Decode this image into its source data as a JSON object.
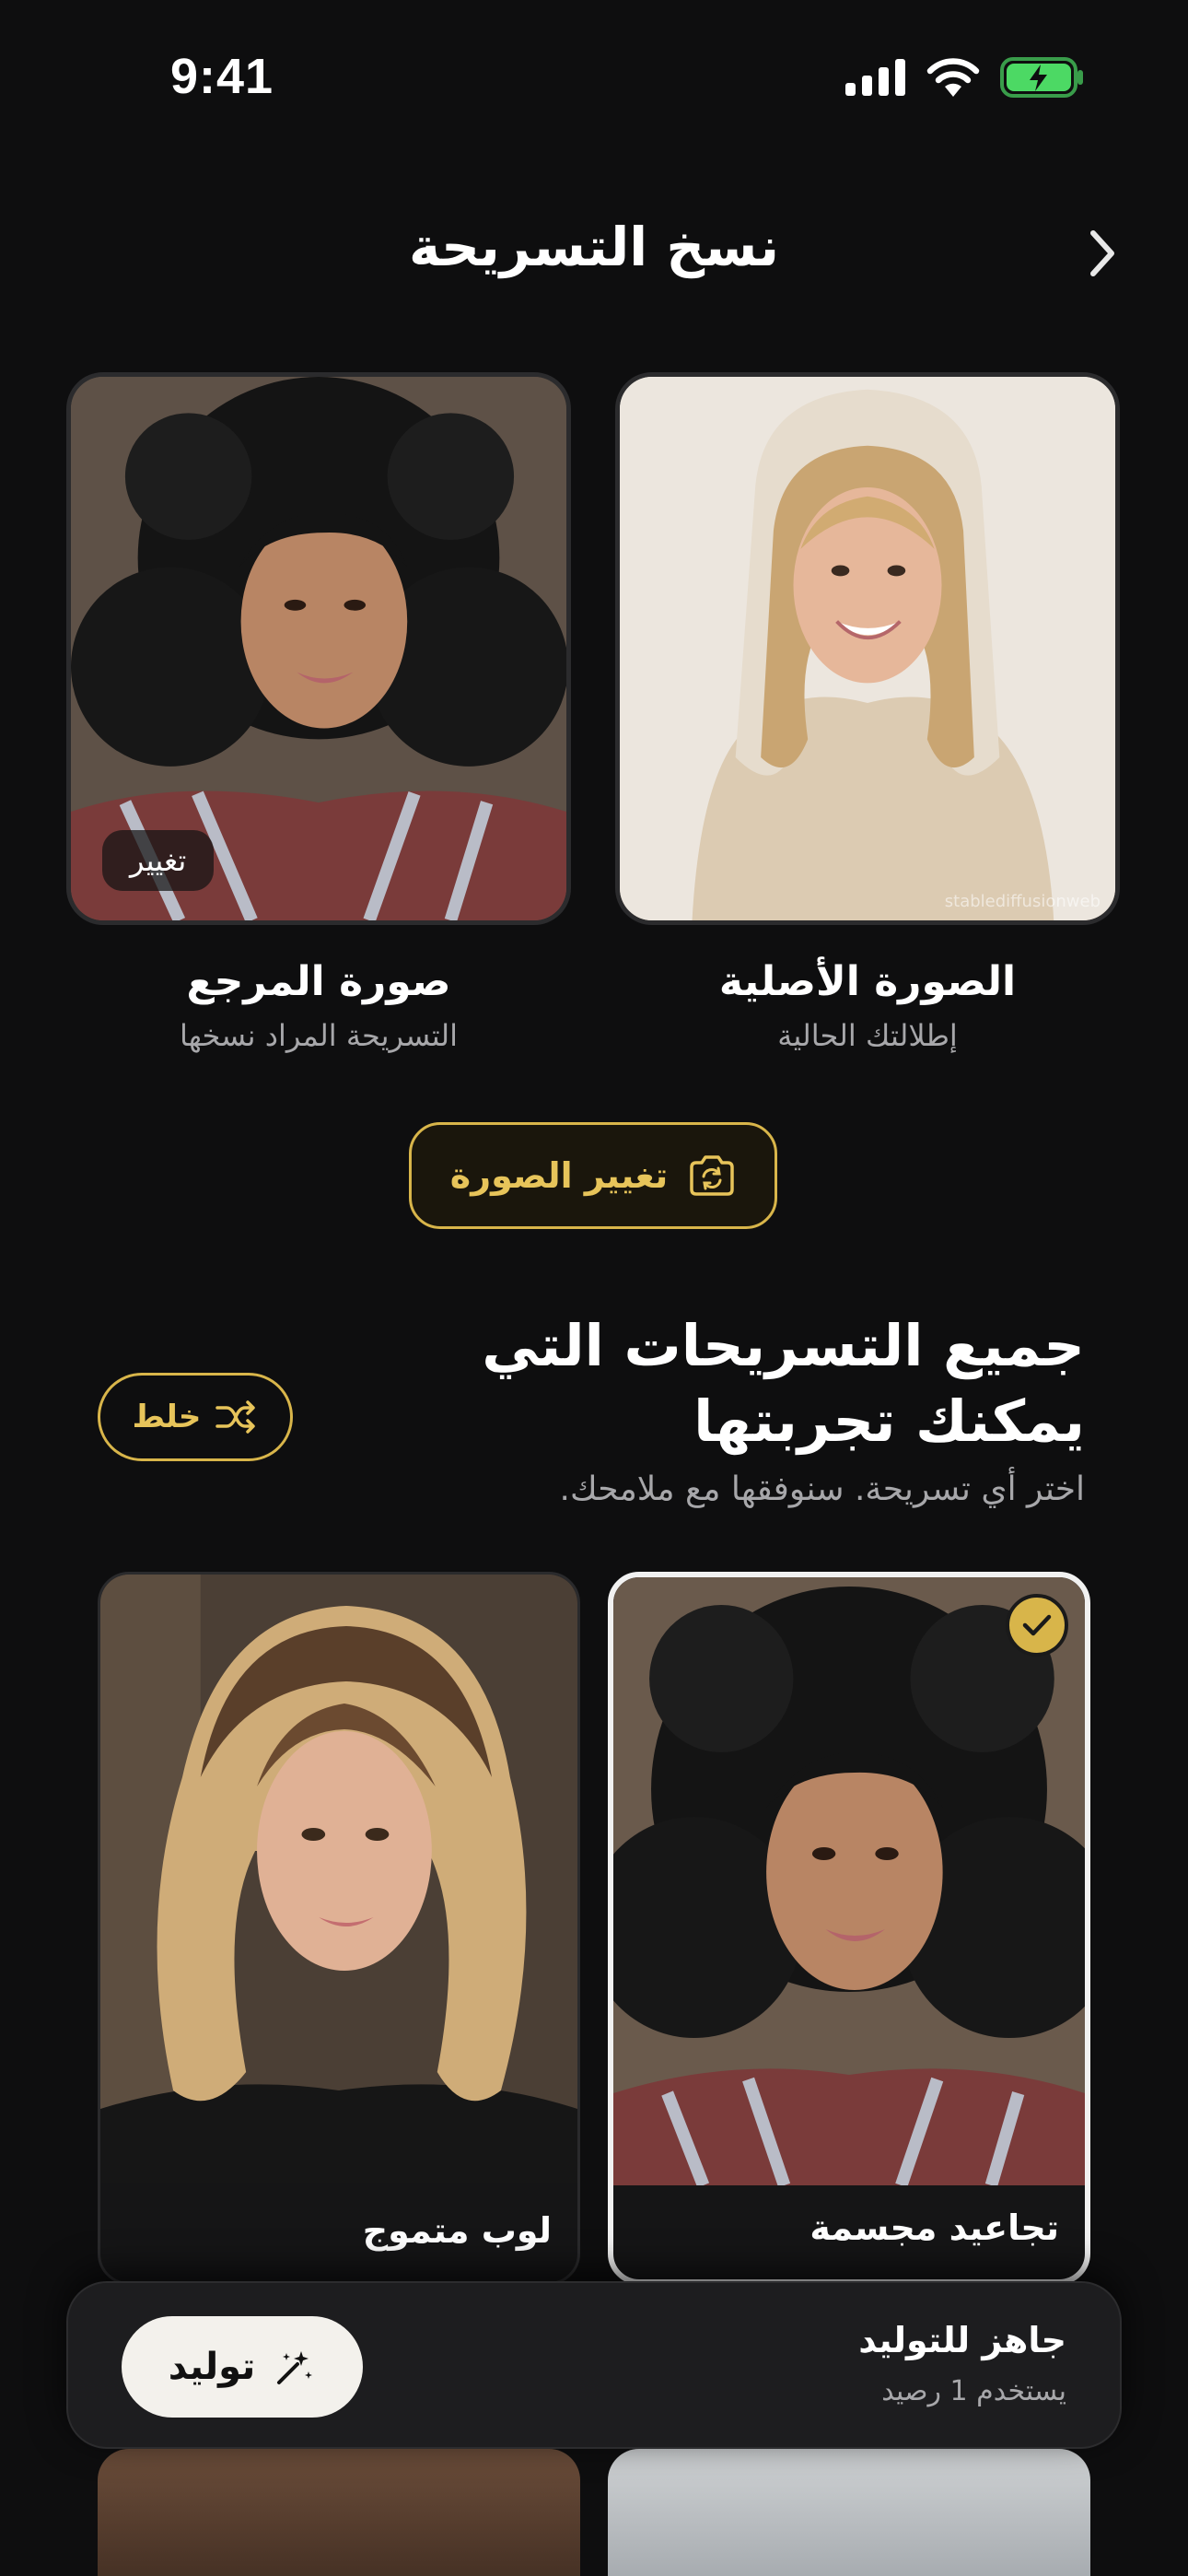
{
  "status_bar": {
    "time": "9:41"
  },
  "header": {
    "title": "نسخ التسريحة"
  },
  "photos": {
    "original": {
      "title": "الصورة الأصلية",
      "subtitle": "إطلالتك الحالية",
      "watermark": "stablediffusionweb"
    },
    "reference": {
      "title": "صورة المرجع",
      "subtitle": "التسريحة المراد نسخها",
      "change_label": "تغيير"
    }
  },
  "change_photo_button": {
    "label": "تغيير الصورة"
  },
  "section": {
    "title_line1": "جميع التسريحات التي",
    "title_line2": "يمكنك تجربتها",
    "subtitle": "اختر أي تسريحة. سنوفقها مع ملامحك.",
    "shuffle_label": "خلط"
  },
  "styles": [
    {
      "label": "تجاعيد مجسمة",
      "selected": true
    },
    {
      "label": "لوب متموج",
      "selected": false
    }
  ],
  "generate_bar": {
    "title": "جاهز للتوليد",
    "subtitle": "يستخدم 1 رصيد",
    "button_label": "توليد"
  },
  "colors": {
    "accent": "#d8b54a",
    "background": "#0e0e0f",
    "button_light": "#f3f1ec"
  },
  "icons": [
    "back-chevron-icon",
    "camera-rotate-icon",
    "shuffle-icon",
    "check-icon",
    "magic-wand-icon",
    "signal-icon",
    "wifi-icon",
    "battery-icon"
  ]
}
